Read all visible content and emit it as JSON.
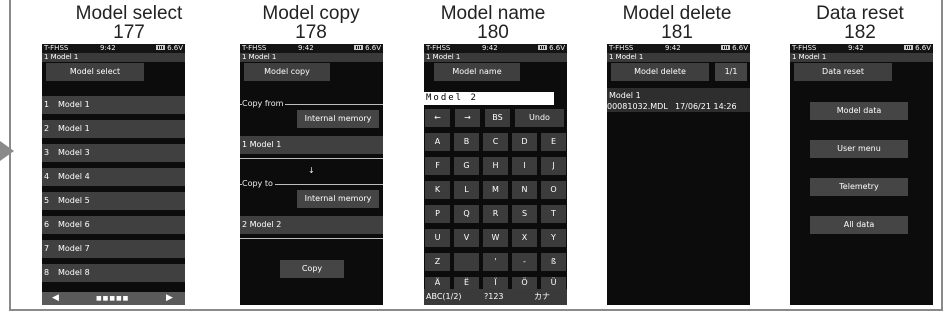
{
  "captions": [
    {
      "title": "Model select",
      "num": "177"
    },
    {
      "title": "Model copy",
      "num": "178"
    },
    {
      "title": "Model name",
      "num": "180"
    },
    {
      "title": "Model delete",
      "num": "181"
    },
    {
      "title": "Data reset",
      "num": "182"
    }
  ],
  "status": {
    "system": "T-FHSS",
    "time": "9:42",
    "voltage": "6.6V",
    "model_line": "1   Model 1"
  },
  "model_select": {
    "title": "Model select",
    "rows": [
      {
        "idx": "1",
        "name": "Model 1"
      },
      {
        "idx": "2",
        "name": "Model 1"
      },
      {
        "idx": "3",
        "name": "Model 3"
      },
      {
        "idx": "4",
        "name": "Model 4"
      },
      {
        "idx": "5",
        "name": "Model 5"
      },
      {
        "idx": "6",
        "name": "Model 6"
      },
      {
        "idx": "7",
        "name": "Model 7"
      },
      {
        "idx": "8",
        "name": "Model 8"
      }
    ],
    "prev": "◀",
    "next": "▶",
    "dots": "■■■■■"
  },
  "model_copy": {
    "title": "Model copy",
    "copy_from": "Copy from",
    "src_button": "Internal memory",
    "src_model": "1  Model 1",
    "arrow": "↓",
    "copy_to": "Copy to",
    "dst_button": "Internal memory",
    "dst_model": "2  Model 2",
    "copy_button": "Copy"
  },
  "model_name": {
    "title": "Model name",
    "value": "Model 2",
    "keys_row1": [
      "←",
      "→",
      "BS",
      "Undo"
    ],
    "keys": [
      [
        "A",
        "B",
        "C",
        "D",
        "E"
      ],
      [
        "F",
        "G",
        "H",
        "I",
        "J"
      ],
      [
        "K",
        "L",
        "M",
        "N",
        "O"
      ],
      [
        "P",
        "Q",
        "R",
        "S",
        "T"
      ],
      [
        "U",
        "V",
        "W",
        "X",
        "Y"
      ],
      [
        "Z",
        "",
        "'",
        "-",
        "ß"
      ],
      [
        "Ä",
        "Ë",
        "Ï",
        "Ö",
        "Ü"
      ]
    ],
    "mode1": "ABC(1/2)",
    "mode2": "?123",
    "mode3": "カナ"
  },
  "model_delete": {
    "title": "Model delete",
    "page": "1/1",
    "model": "Model 1",
    "file": "00081032.MDL",
    "date": "17/06/21 14:26"
  },
  "data_reset": {
    "title": "Data reset",
    "buttons": [
      "Model data",
      "User menu",
      "Telemetry",
      "All data"
    ]
  }
}
